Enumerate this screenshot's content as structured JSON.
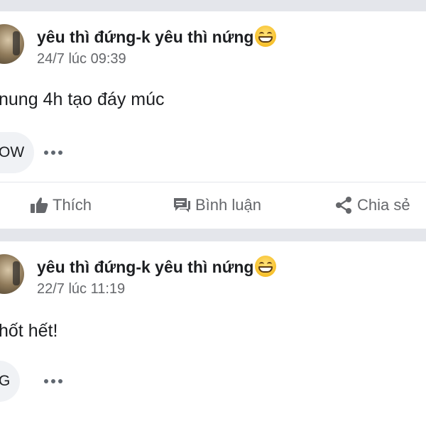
{
  "posts": [
    {
      "author": "yêu thì đứng-k yêu thì nứng",
      "author_emoji": "grinning-face-emoji",
      "timestamp": "24/7 lúc 09:39",
      "text": "nung 4h tạo đáy múc",
      "reaction_label": "OW",
      "actions": {
        "like": "Thích",
        "comment": "Bình luận",
        "share": "Chia sẻ"
      }
    },
    {
      "author": "yêu thì đứng-k yêu thì nứng",
      "author_emoji": "grinning-face-emoji",
      "timestamp": "22/7 lúc 11:19",
      "text": "hốt hết!",
      "reaction_label": "G"
    }
  ],
  "colors": {
    "separator": "#e4e6eb",
    "secondary_text": "#65676b",
    "pill_background": "#f0f2f5",
    "primary_text": "#1c1e21"
  }
}
